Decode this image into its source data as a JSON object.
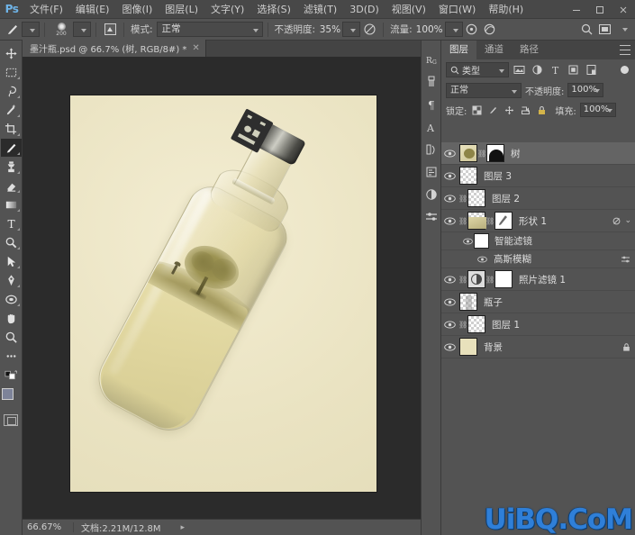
{
  "app": {
    "logo": "Ps",
    "menus": [
      {
        "label": "文件(F)"
      },
      {
        "label": "编辑(E)"
      },
      {
        "label": "图像(I)"
      },
      {
        "label": "图层(L)"
      },
      {
        "label": "文字(Y)"
      },
      {
        "label": "选择(S)"
      },
      {
        "label": "滤镜(T)"
      },
      {
        "label": "3D(D)"
      },
      {
        "label": "视图(V)"
      },
      {
        "label": "窗口(W)"
      },
      {
        "label": "帮助(H)"
      }
    ],
    "window_controls": {
      "minimize": "—",
      "maximize": "▢",
      "close": "✕"
    }
  },
  "options_bar": {
    "tool_icon": "brush-tool-icon",
    "brush_size": "200",
    "mode_label": "模式:",
    "mode_value": "正常",
    "opacity_label": "不透明度:",
    "opacity_value": "35%",
    "flow_label": "流量:",
    "flow_value": "100%",
    "airbrush_icon": "airbrush-icon",
    "pressure_size_icon": "pressure-size-icon",
    "smoothing_icon": "smoothing-icon",
    "search_icon": "search-icon",
    "workspace_icon": "workspace-switcher-icon"
  },
  "tabs": {
    "documents": [
      {
        "title": "墨汁瓶.psd @ 66.7% (树, RGB/8#) *",
        "close": "✕",
        "active": true
      }
    ]
  },
  "toolbar": {
    "tools": [
      {
        "name": "move-tool",
        "glyph": "move"
      },
      {
        "name": "marquee-tool",
        "glyph": "marquee"
      },
      {
        "name": "lasso-tool",
        "glyph": "lasso"
      },
      {
        "name": "quick-selection-tool",
        "glyph": "wand"
      },
      {
        "name": "crop-tool",
        "glyph": "crop"
      },
      {
        "name": "brush-tool",
        "glyph": "brush",
        "active": true
      },
      {
        "name": "clone-stamp-tool",
        "glyph": "stamp"
      },
      {
        "name": "eraser-tool",
        "glyph": "eraser"
      },
      {
        "name": "gradient-tool",
        "glyph": "gradient"
      },
      {
        "name": "type-tool",
        "glyph": "T"
      },
      {
        "name": "dodge-tool",
        "glyph": "dodge"
      },
      {
        "name": "path-selection-tool",
        "glyph": "arrow"
      },
      {
        "name": "pen-tool",
        "glyph": "pen"
      },
      {
        "name": "shape-tool",
        "glyph": "ellipse"
      },
      {
        "name": "hand-tool",
        "glyph": "hand"
      },
      {
        "name": "zoom-tool",
        "glyph": "zoom"
      },
      {
        "name": "edit-toolbar",
        "glyph": "dots"
      }
    ],
    "foreground_color": "#7d8399",
    "background_color": "#ffffff",
    "quick_mask": "quick-mask-icon"
  },
  "canvas": {
    "artwork_name": "bottle-with-tree-artwork",
    "background_color": "#efe8c8",
    "bottle_liquid_color": "#e2d9a8",
    "tree_color": "#8d8447",
    "cap_label_color": "#2e2e2e"
  },
  "status_bar": {
    "zoom": "66.67%",
    "doc_label": "文档:2.21M/12.8M",
    "expand_arrow": "▸"
  },
  "dock_strip": {
    "icons": [
      {
        "name": "color-panel-icon",
        "glyph": "Rg"
      },
      {
        "name": "brushes-panel-icon",
        "glyph": "brush"
      },
      {
        "name": "paragraph-panel-icon",
        "glyph": "¶"
      },
      {
        "name": "character-panel-icon",
        "glyph": "A"
      },
      {
        "name": "history-panel-icon",
        "glyph": "history"
      },
      {
        "name": "actions-panel-icon",
        "glyph": "actions"
      },
      {
        "name": "adjustments-panel-icon",
        "glyph": "halfcircle"
      },
      {
        "name": "properties-panel-icon",
        "glyph": "sliders"
      }
    ]
  },
  "layers_panel": {
    "tabs": [
      {
        "label": "图层",
        "active": true
      },
      {
        "label": "通道",
        "active": false
      },
      {
        "label": "路径",
        "active": false
      }
    ],
    "filter": {
      "kind_label": "类型",
      "search_icon": "search-icon",
      "icons": [
        {
          "name": "filter-pixel-icon"
        },
        {
          "name": "filter-adjustment-icon"
        },
        {
          "name": "filter-type-icon"
        },
        {
          "name": "filter-shape-icon"
        },
        {
          "name": "filter-smart-object-icon"
        }
      ],
      "toggle": "filter-enable-toggle"
    },
    "blend": {
      "mode": "正常",
      "opacity_label": "不透明度:",
      "opacity_value": "100%"
    },
    "lock": {
      "label": "锁定:",
      "icons": [
        {
          "name": "lock-transparent-pixels-icon"
        },
        {
          "name": "lock-image-pixels-icon"
        },
        {
          "name": "lock-position-icon"
        },
        {
          "name": "lock-artboard-nesting-icon"
        },
        {
          "name": "lock-all-icon"
        }
      ],
      "fill_label": "填充:",
      "fill_value": "100%"
    },
    "layers": [
      {
        "name": "树",
        "visible": true,
        "selected": true,
        "thumb": "tree",
        "has_mask": true,
        "linked": true,
        "type": "layer"
      },
      {
        "name": "图层 3",
        "visible": true,
        "selected": false,
        "thumb": "empty",
        "has_mask": false,
        "linked": false,
        "type": "layer"
      },
      {
        "name": "图层 2",
        "visible": true,
        "selected": false,
        "thumb": "empty",
        "has_mask": false,
        "linked": true,
        "type": "layer"
      },
      {
        "name": "形状 1",
        "visible": true,
        "selected": false,
        "thumb": "shape",
        "has_mask": true,
        "linked": true,
        "type": "smart-object",
        "fx": "fx-arrow"
      },
      {
        "name": "智能滤镜",
        "visible": true,
        "type": "smart-filter-header",
        "indent": 1,
        "thumb": "white"
      },
      {
        "name": "高斯模糊",
        "visible": true,
        "type": "smart-filter-item",
        "indent": 2,
        "options": "filter-blending-options-icon"
      },
      {
        "name": "照片滤镜 1",
        "visible": true,
        "selected": false,
        "thumb": "white",
        "has_mask": true,
        "linked": true,
        "type": "adjustment"
      },
      {
        "name": "瓶子",
        "visible": true,
        "selected": false,
        "thumb": "bottle",
        "has_mask": false,
        "linked": false,
        "type": "layer"
      },
      {
        "name": "图层 1",
        "visible": true,
        "selected": false,
        "thumb": "empty",
        "has_mask": false,
        "linked": true,
        "type": "layer"
      },
      {
        "name": "背景",
        "visible": true,
        "selected": false,
        "thumb": "background",
        "has_mask": false,
        "linked": false,
        "type": "background",
        "locked_icon": "lock-icon"
      }
    ]
  },
  "watermark": {
    "text": "UiBQ.CoM",
    "color": "#2f7fd8"
  }
}
